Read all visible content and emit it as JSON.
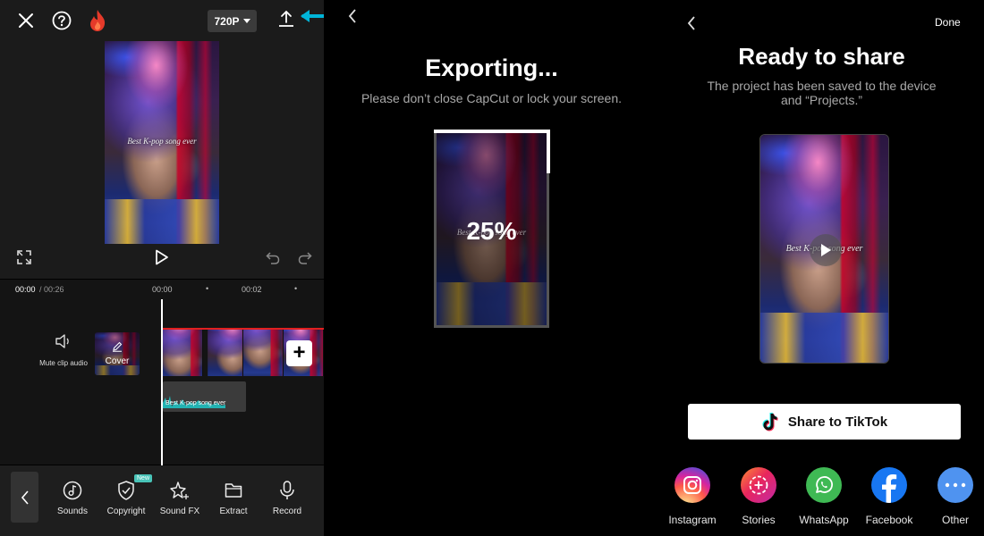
{
  "editor": {
    "resolution": "720P",
    "video_caption": "Best K-pop song ever",
    "time_current": "00:00",
    "time_total": "/ 00:26",
    "ruler_marks": [
      "00:00",
      "00:02"
    ],
    "mute_label": "Mute clip audio",
    "cover_label": "Cover",
    "text_track_label": "Best K-pop song ever",
    "toolbar": [
      {
        "label": "Sounds",
        "icon": "music-note-icon"
      },
      {
        "label": "Copyright",
        "icon": "shield-check-icon",
        "badge": "New"
      },
      {
        "label": "Sound FX",
        "icon": "sparkle-star-icon"
      },
      {
        "label": "Extract",
        "icon": "folder-icon"
      },
      {
        "label": "Record",
        "icon": "microphone-icon"
      }
    ],
    "accent_color": "#00b4d8"
  },
  "exporting": {
    "title": "Exporting...",
    "subtitle": "Please don’t close CapCut or lock your screen.",
    "progress_label": "25%",
    "progress": 0.25,
    "video_caption": "Best K-pop song ever"
  },
  "share": {
    "done_label": "Done",
    "title": "Ready to share",
    "subtitle": "The project has been saved to the device and “Projects.”",
    "video_caption": "Best K-pop song ever",
    "tiktok_label": "Share to TikTok",
    "targets": [
      {
        "label": "Instagram",
        "icon": "instagram-icon"
      },
      {
        "label": "Stories",
        "icon": "stories-icon"
      },
      {
        "label": "WhatsApp",
        "icon": "whatsapp-icon"
      },
      {
        "label": "Facebook",
        "icon": "facebook-icon"
      },
      {
        "label": "Other",
        "icon": "more-icon"
      }
    ]
  }
}
